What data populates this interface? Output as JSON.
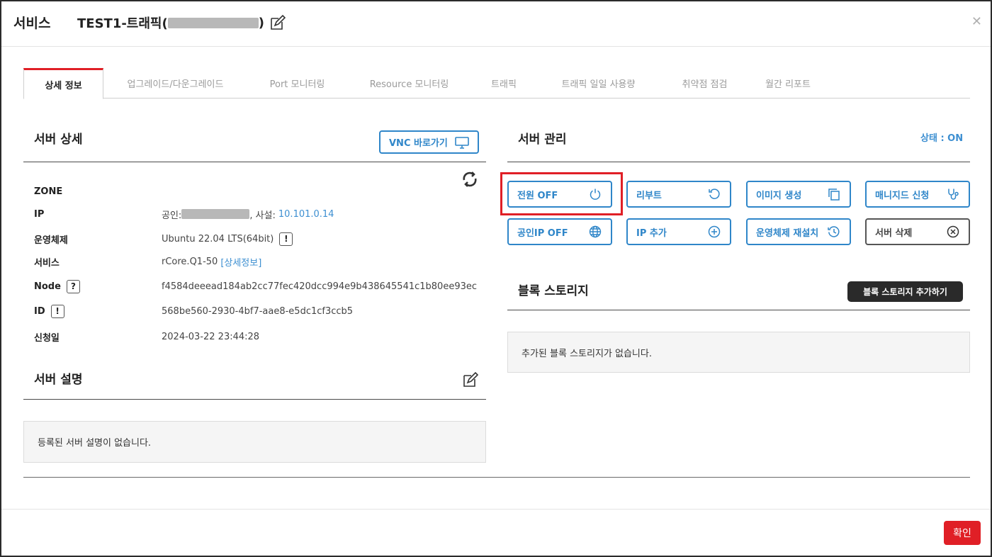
{
  "header": {
    "title": "서비스",
    "server_name_prefix": "TEST1-트래픽(",
    "server_name_suffix": ")"
  },
  "tabs": [
    {
      "label": "상세 정보",
      "active": true
    },
    {
      "label": "업그레이드/다운그레이드",
      "active": false
    },
    {
      "label": "Port 모니터링",
      "active": false
    },
    {
      "label": "Resource 모니터링",
      "active": false
    },
    {
      "label": "트래픽",
      "active": false
    },
    {
      "label": "트래픽 일일 사용량",
      "active": false
    },
    {
      "label": "취약점 점검",
      "active": false
    },
    {
      "label": "월간 리포트",
      "active": false
    }
  ],
  "server_detail": {
    "title": "서버 상세",
    "vnc_button": "VNC 바로가기",
    "rows": [
      {
        "label": "ZONE",
        "value": ""
      },
      {
        "label": "IP",
        "public_prefix": "공인:",
        "private_prefix": ", 사설:",
        "private_ip": "10.101.0.14"
      },
      {
        "label": "운영체제",
        "value": "Ubuntu 22.04 LTS(64bit)"
      },
      {
        "label": "서비스",
        "value": "rCore.Q1-50",
        "link": "[상세정보]"
      },
      {
        "label": "Node",
        "value": "f4584deeead184ab2cc77fec420dcc994e9b438645541c1b80ee93ec"
      },
      {
        "label": "ID",
        "value": "568be560-2930-4bf7-aae8-e5dc1cf3ccb5"
      },
      {
        "label": "신청일",
        "value": "2024-03-22 23:44:28"
      }
    ],
    "badge_exclaim": "!",
    "badge_question": "?"
  },
  "server_description": {
    "title": "서버 설명",
    "empty_text": "등록된 서버 설명이 없습니다."
  },
  "server_manage": {
    "title": "서버 관리",
    "status": "상태 : ON",
    "buttons": [
      {
        "label": "전원 OFF",
        "icon": "power-icon"
      },
      {
        "label": "리부트",
        "icon": "reboot-icon"
      },
      {
        "label": "이미지 생성",
        "icon": "copy-icon"
      },
      {
        "label": "매니지드 신청",
        "icon": "stethoscope-icon"
      },
      {
        "label": "공인IP OFF",
        "icon": "globe-icon"
      },
      {
        "label": "IP 추가",
        "icon": "plus-circle-icon"
      },
      {
        "label": "운영체제 재설치",
        "icon": "history-icon"
      },
      {
        "label": "서버 삭제",
        "icon": "close-circle-icon"
      }
    ]
  },
  "block_storage": {
    "title": "블록 스토리지",
    "add_button": "블록 스토리지 추가하기",
    "empty_text": "추가된 블록 스토리지가 없습니다."
  },
  "footer": {
    "confirm": "확인"
  },
  "colors": {
    "accent_red": "#e01f26",
    "accent_blue": "#2f86c9",
    "link_blue": "#3d8fd1"
  }
}
